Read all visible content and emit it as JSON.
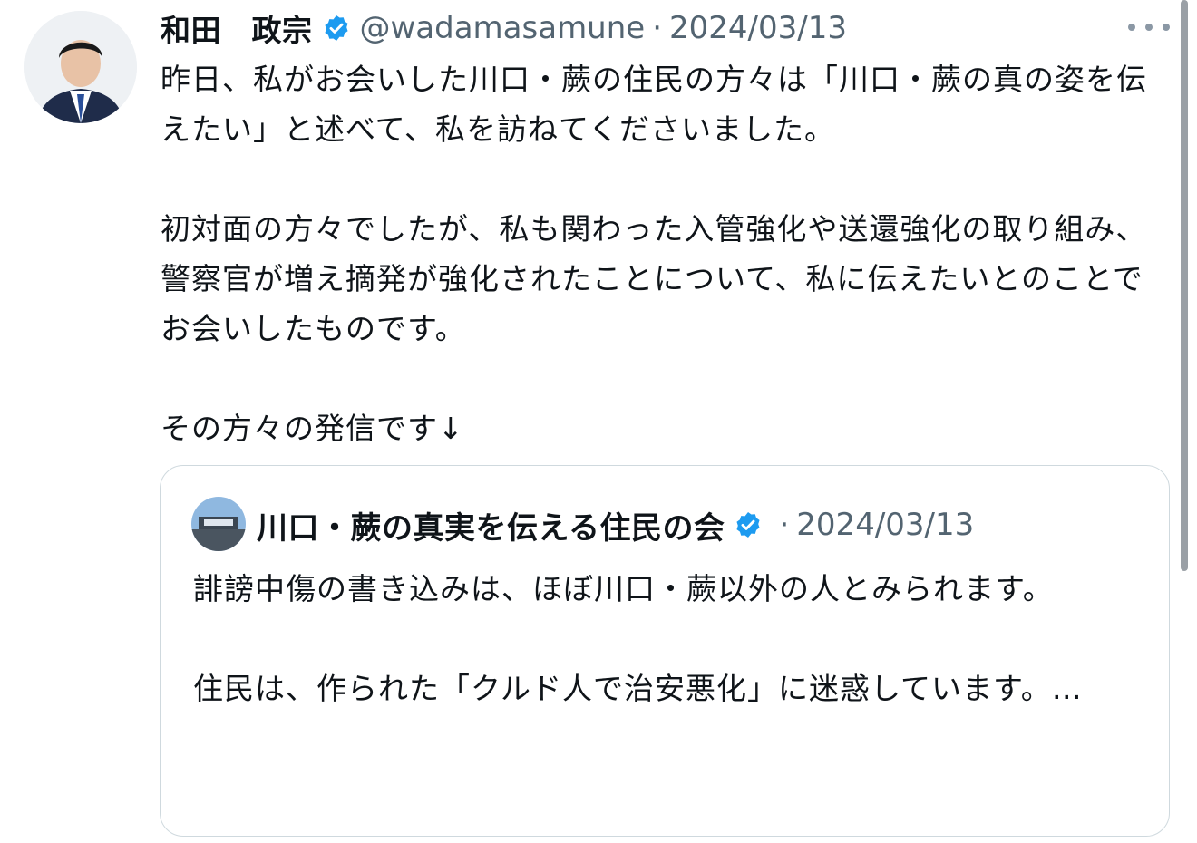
{
  "tweet": {
    "author_name": "和田　政宗",
    "handle": "@wadamasamune",
    "separator": "·",
    "date": "2024/03/13",
    "paragraphs": [
      "昨日、私がお会いした川口・蕨の住民の方々は「川口・蕨の真の姿を伝えたい」と述べて、私を訪ねてくださいました。",
      "初対面の方々でしたが、私も関わった入管強化や送還強化の取り組み、警察官が増え摘発が強化されたことについて、私に伝えたいとのことでお会いしたものです。",
      "その方々の発信です↓"
    ]
  },
  "quoted": {
    "author_name": "川口・蕨の真実を伝える住民の会",
    "separator": "·",
    "date": "2024/03/13",
    "paragraphs": [
      "誹謗中傷の書き込みは、ほぼ川口・蕨以外の人とみられます。",
      "住民は、作られた「クルド人で治安悪化」に迷惑しています。…"
    ]
  },
  "icons": {
    "verified": "verified-badge-icon",
    "more": "more-options-icon"
  },
  "colors": {
    "verified": "#1d9bf0",
    "secondary_text": "#536471",
    "border": "#cfd9de"
  }
}
